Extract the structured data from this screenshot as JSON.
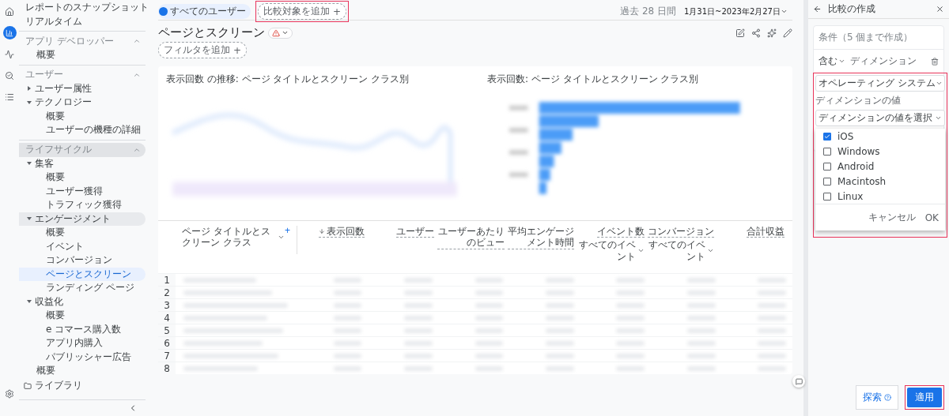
{
  "sidebar": {
    "top_links": [
      {
        "label": "レポートのスナップショット"
      },
      {
        "label": "リアルタイム"
      }
    ],
    "sections": [
      {
        "title": "アプリ デベロッパー",
        "expanded": true,
        "highlighted": false,
        "children": [
          {
            "label": "概要",
            "selected": false
          }
        ]
      },
      {
        "title": "ユーザー",
        "expanded": true,
        "highlighted": false,
        "children": [
          {
            "label": "ユーザー属性",
            "expanded": false,
            "selected": false
          },
          {
            "label": "テクノロジー",
            "expanded": true,
            "selected": false,
            "children": [
              {
                "label": "概要",
                "selected": false
              },
              {
                "label": "ユーザーの機種の詳細",
                "selected": false
              }
            ]
          }
        ]
      },
      {
        "title": "ライフサイクル",
        "expanded": true,
        "highlighted": true,
        "children": [
          {
            "label": "集客",
            "expanded": true,
            "selected": false,
            "children": [
              {
                "label": "概要",
                "selected": false
              },
              {
                "label": "ユーザー獲得",
                "selected": false
              },
              {
                "label": "トラフィック獲得",
                "selected": false
              }
            ]
          },
          {
            "label": "エンゲージメント",
            "expanded": true,
            "selected": true,
            "children": [
              {
                "label": "概要",
                "selected": false
              },
              {
                "label": "イベント",
                "selected": false
              },
              {
                "label": "コンバージョン",
                "selected": false
              },
              {
                "label": "ページとスクリーン",
                "selected": true
              },
              {
                "label": "ランディング ページ",
                "selected": false
              }
            ]
          },
          {
            "label": "収益化",
            "expanded": true,
            "selected": false,
            "children": [
              {
                "label": "概要",
                "selected": false
              },
              {
                "label": "e コマース購入数",
                "selected": false
              },
              {
                "label": "アプリ内購入",
                "selected": false
              },
              {
                "label": "パブリッシャー広告",
                "selected": false
              }
            ]
          },
          {
            "label": "概要",
            "selected": false
          }
        ]
      }
    ],
    "library": "ライブラリ"
  },
  "topbar": {
    "segment": "すべてのユーザー",
    "compare": {
      "label": "比較対象を追加",
      "icon": "+",
      "highlighted": true
    },
    "date_caption": "過去 28 日間",
    "date_range": "1月31日~2023年2月27日"
  },
  "report": {
    "title": "ページとスクリーン",
    "filter": {
      "label": "フィルタを追加",
      "icon": "+"
    }
  },
  "charts": [
    {
      "title": "表示回数 の推移: ページ タイトルとスクリーン クラス別",
      "kind": "line"
    },
    {
      "title": "表示回数: ページ タイトルとスクリーン クラス別",
      "kind": "bar"
    }
  ],
  "table": {
    "dimension": "ページ タイトルとスクリーン クラス",
    "add": "+",
    "columns": [
      {
        "label": "表示回数",
        "sorted": true
      },
      {
        "label": "ユーザー",
        "sorted": false
      },
      {
        "label": "ユーザーあたりのビュー",
        "sorted": false
      },
      {
        "label": "平均エンゲージメント時間",
        "sorted": false
      },
      {
        "label": "イベント数",
        "sub": "すべてのイベント",
        "sorted": false
      },
      {
        "label": "コンバージョン",
        "sub": "すべてのイベント",
        "sorted": false
      },
      {
        "label": "合計収益",
        "sorted": false
      }
    ],
    "rows": [
      "1",
      "2",
      "3",
      "4",
      "5",
      "6",
      "7",
      "8"
    ]
  },
  "panel": {
    "title": "比較の作成",
    "caption": "条件（5 個まで作成）",
    "operator": "含む",
    "dimension_label": "ディメンション",
    "highlighted": true,
    "dimension": "オペレーティング システム",
    "values_label": "ディメンションの値",
    "values_placeholder": "ディメンションの値を選択",
    "options": [
      {
        "label": "iOS",
        "checked": true
      },
      {
        "label": "Windows",
        "checked": false
      },
      {
        "label": "Android",
        "checked": false
      },
      {
        "label": "Macintosh",
        "checked": false
      },
      {
        "label": "Linux",
        "checked": false
      }
    ],
    "cancel": "キャンセル",
    "ok": "OK",
    "explore": "探索",
    "apply": {
      "label": "適用",
      "highlighted": true
    }
  }
}
